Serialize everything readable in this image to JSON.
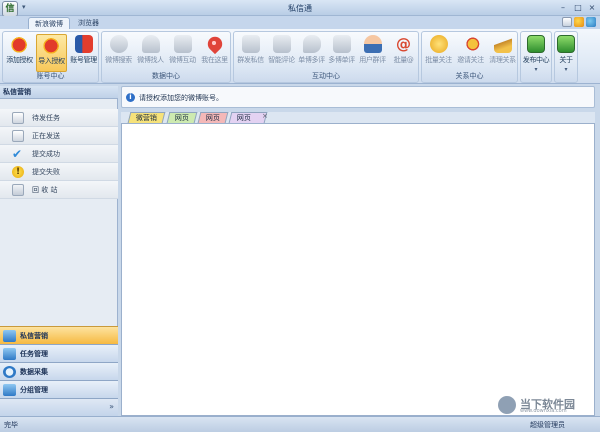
{
  "window": {
    "title": "私信通",
    "quick_access": "▾"
  },
  "tabs": [
    {
      "label": "新浪微博"
    },
    {
      "label": "浏览器"
    }
  ],
  "ribbon": {
    "groups": {
      "account": {
        "label": "账号中心",
        "buttons": [
          "添加授权",
          "导入授权",
          "账号管理"
        ]
      },
      "data": {
        "label": "数据中心",
        "buttons": [
          "微博搜索",
          "微博找人",
          "微博互动",
          "我在这里"
        ]
      },
      "interact": {
        "label": "互动中心",
        "buttons": [
          "群发私信",
          "智能评论",
          "单博多评",
          "多博单评",
          "用户群评",
          "批量@"
        ]
      },
      "relation": {
        "label": "关系中心",
        "buttons": [
          "批量关注",
          "邀请关注",
          "清理关系"
        ]
      },
      "publish": {
        "label": "发布中心",
        "arrow": "▾"
      },
      "about": {
        "label": "关于",
        "arrow": "▾"
      }
    }
  },
  "left_panel": {
    "title": "私信营销",
    "items": [
      "待发任务",
      "正在发送",
      "提交成功",
      "提交失败",
      "回 收 站"
    ],
    "accordion": [
      "私信营销",
      "任务管理",
      "数据采集",
      "分组管理"
    ],
    "expand_glyph": "»"
  },
  "info_bar": {
    "icon": "i",
    "text": "请授权添加您的微博账号。"
  },
  "content_tabs": [
    {
      "label": "微营销",
      "color": "#f6e27a"
    },
    {
      "label": "网页",
      "color": "#cdeab0"
    },
    {
      "label": "网页",
      "color": "#f4b8b8"
    },
    {
      "label": "网页",
      "color": "#e3d2f2"
    }
  ],
  "content_tab_close": "×",
  "status": {
    "left": "完毕",
    "right": "超级管理员"
  },
  "watermark": {
    "name": "当下软件园",
    "url": "www.downxia.com"
  }
}
